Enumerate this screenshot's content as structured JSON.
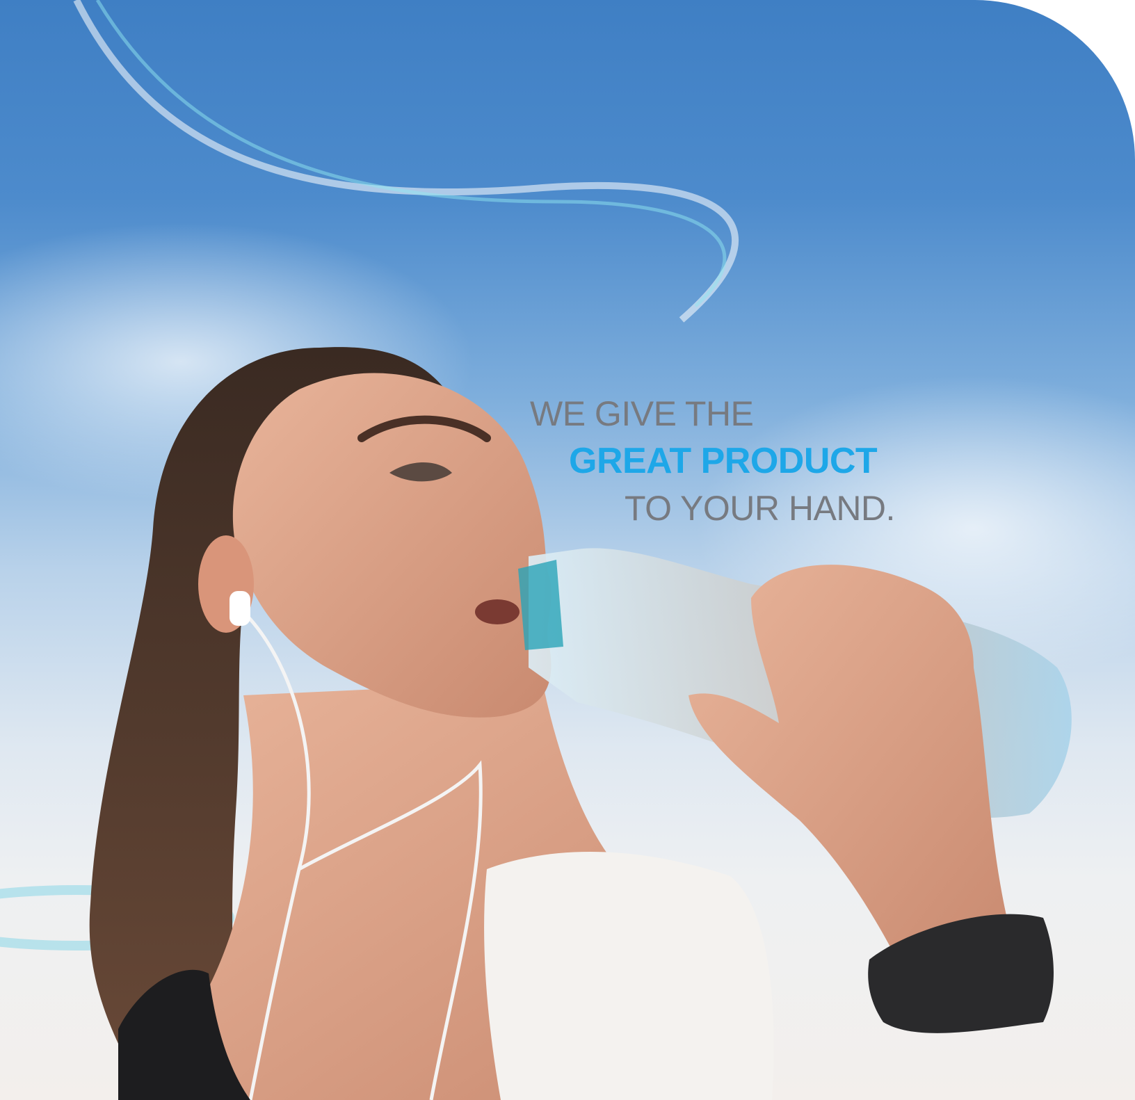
{
  "hero": {
    "headline_line1": "WE GIVE THE",
    "headline_line2": "GREAT PRODUCT",
    "headline_line3": "TO YOUR HAND."
  },
  "colors": {
    "accent": "#1ea7e8",
    "text_gray": "#777a80",
    "sky_top": "#3f7fc4",
    "sky_bottom": "#f3efec"
  },
  "photo": {
    "subject": "woman-drinking-water-photo"
  }
}
